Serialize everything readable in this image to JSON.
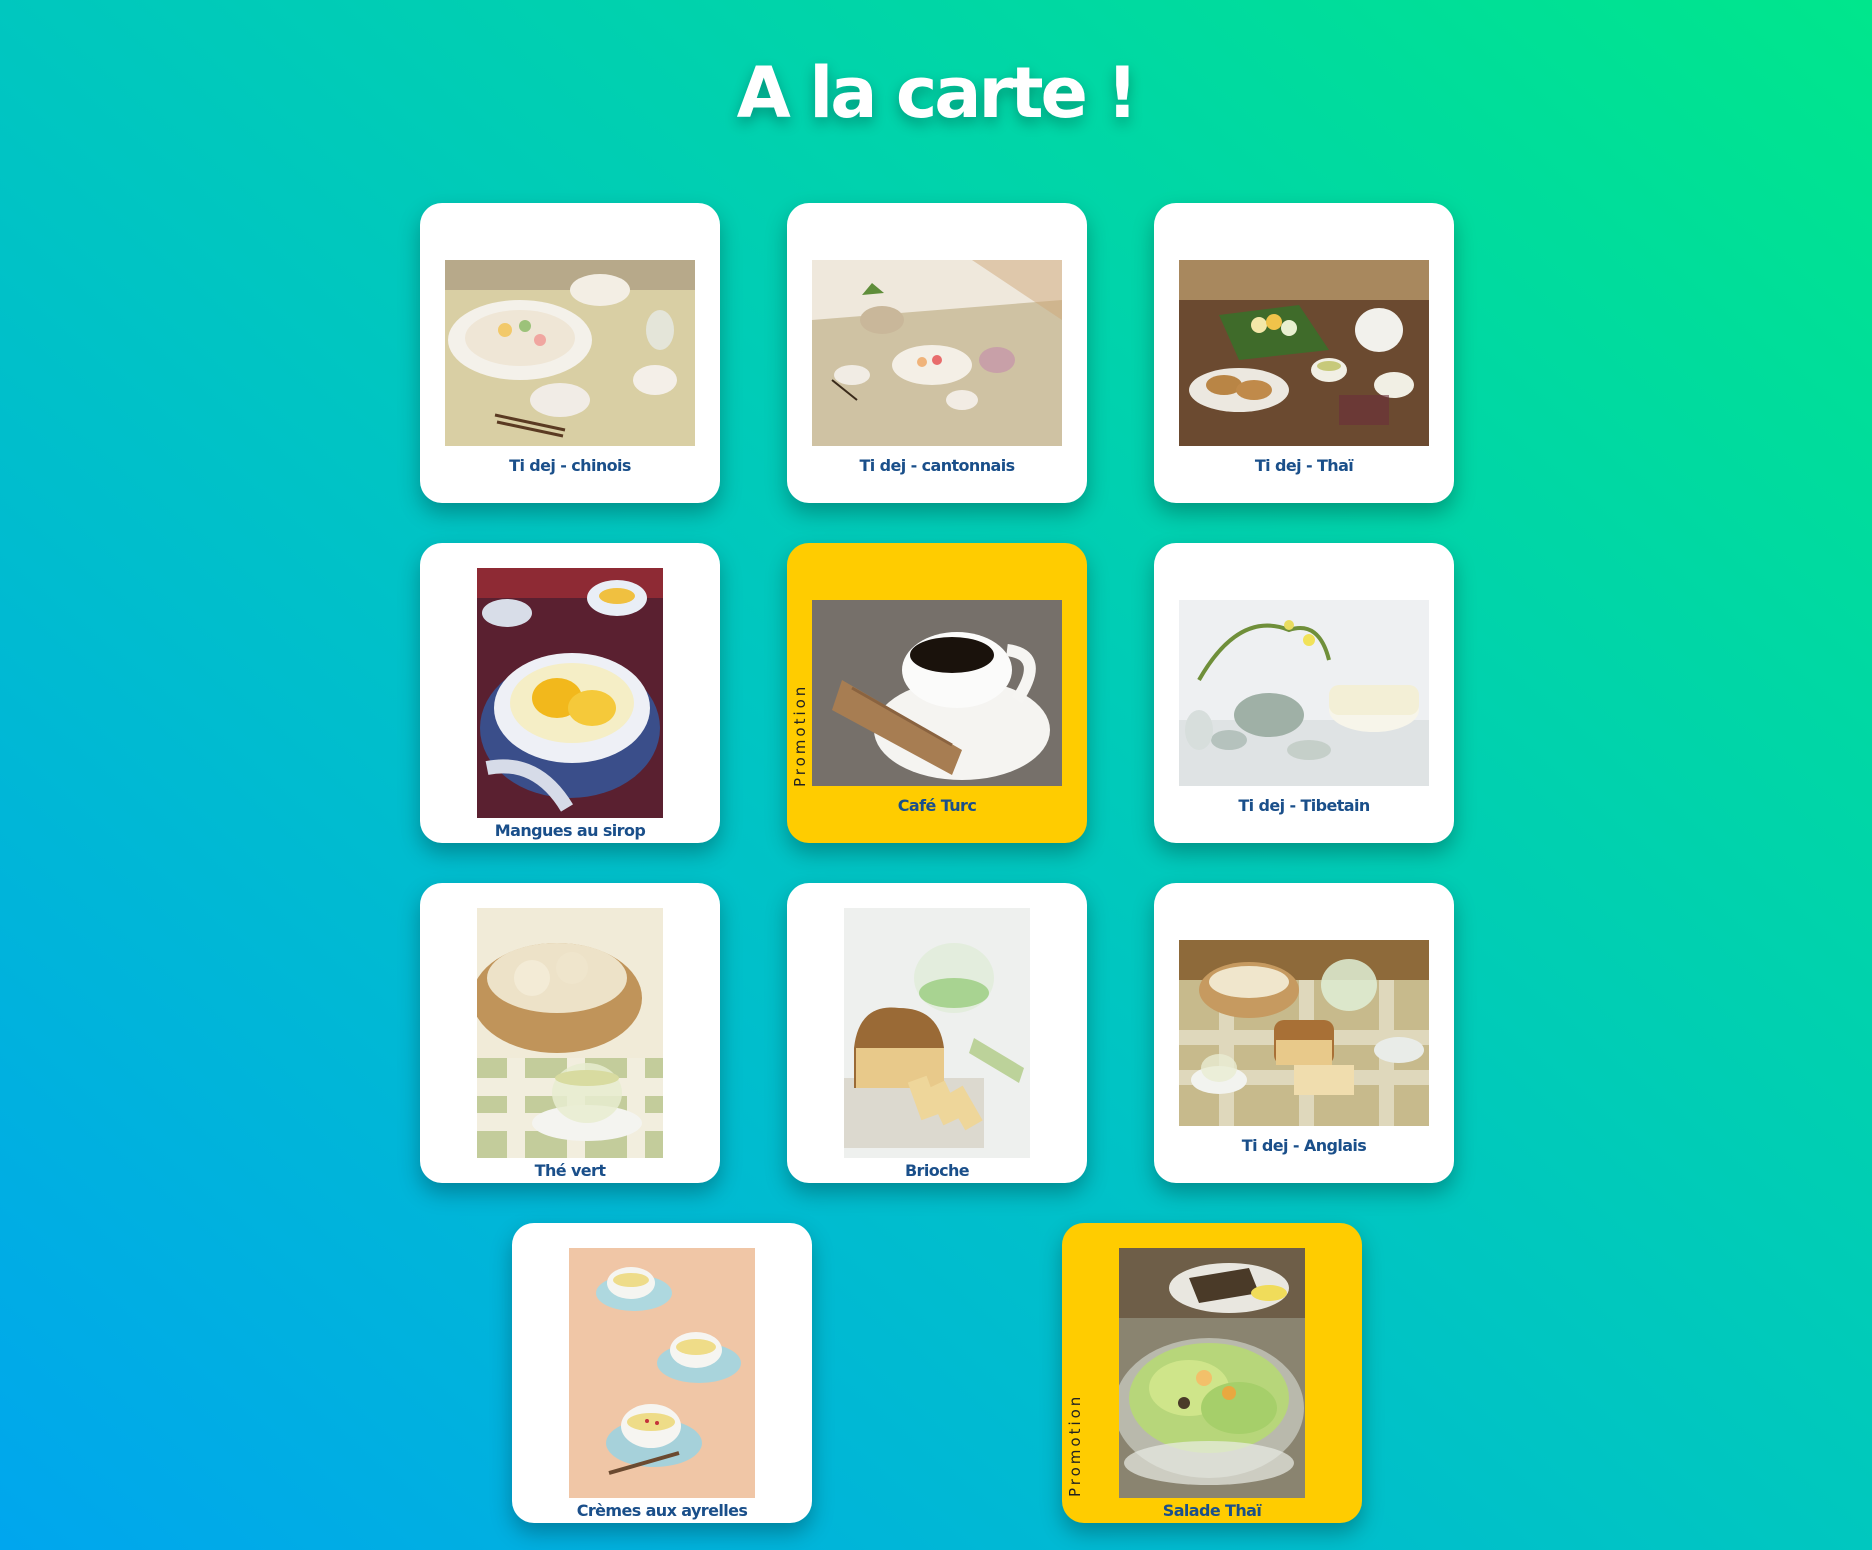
{
  "title": "A la carte !",
  "promo_label": "Promotion",
  "colors": {
    "card": "#ffffff",
    "promo_card": "#ffcc00",
    "label": "#1a4f8a",
    "title": "#ffffff"
  },
  "items": [
    {
      "label": "Ti dej - chinois",
      "promo": false,
      "photo": "table-setting-chinese"
    },
    {
      "label": "Ti dej - cantonnais",
      "promo": false,
      "photo": "table-setting-cantonese"
    },
    {
      "label": "Ti dej - Thaï",
      "promo": false,
      "photo": "tea-sweets-thai"
    },
    {
      "label": "Mangues au sirop",
      "promo": false,
      "photo": "mango-bowl"
    },
    {
      "label": "Café Turc",
      "promo": true,
      "photo": "coffee-biscotti"
    },
    {
      "label": "Ti dej - Tibetain",
      "promo": false,
      "photo": "tibetan-tea-cake"
    },
    {
      "label": "Thé vert",
      "promo": false,
      "photo": "green-tea-bread-basket"
    },
    {
      "label": "Brioche",
      "promo": false,
      "photo": "brioche-loaf"
    },
    {
      "label": "Ti dej - Anglais",
      "promo": false,
      "photo": "english-breakfast"
    },
    {
      "label": "Crèmes aux ayrelles",
      "promo": false,
      "photo": "cream-cups"
    },
    {
      "label": "Salade Thaï",
      "promo": true,
      "photo": "thai-salad"
    }
  ]
}
